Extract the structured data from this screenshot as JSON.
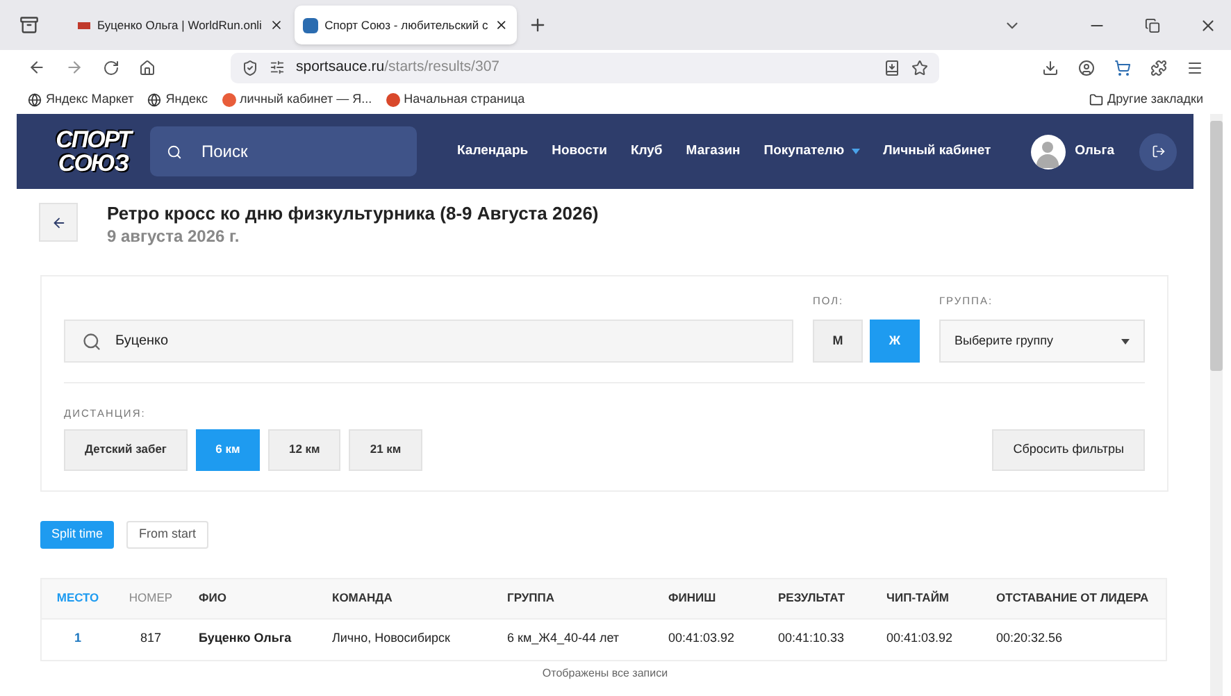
{
  "browser": {
    "tabs": [
      {
        "title": "Буценко Ольга | WorldRun.onli",
        "selected": false
      },
      {
        "title": "Спорт Союз - любительский с",
        "selected": true
      }
    ],
    "url_host": "sportsauce.ru",
    "url_path": "/starts/results/307",
    "bookmarks": [
      "Яндекс Маркет",
      "Яндекс",
      "личный кабинет — Я...",
      "Начальная страница"
    ],
    "other_bookmarks": "Другие закладки"
  },
  "header": {
    "logo_top": "СПОРТ",
    "logo_bottom": "СОЮЗ",
    "search_placeholder": "Поиск",
    "nav": [
      {
        "label": "Календарь",
        "dropdown": false
      },
      {
        "label": "Новости",
        "dropdown": false
      },
      {
        "label": "Клуб",
        "dropdown": false
      },
      {
        "label": "Магазин",
        "dropdown": false
      },
      {
        "label": "Покупателю",
        "dropdown": true
      },
      {
        "label": "Личный кабинет",
        "dropdown": false
      }
    ],
    "user": "Ольга"
  },
  "event": {
    "title": "Ретро кросс ко дню физкультурника (8-9 Августа 2026)",
    "date": "9 августа 2026 г."
  },
  "filters": {
    "search_value": "Буценко",
    "gender_label": "ПОЛ:",
    "genders": [
      {
        "label": "М",
        "selected": false
      },
      {
        "label": "Ж",
        "selected": true
      }
    ],
    "group_label": "ГРУППА:",
    "group_placeholder": "Выберите группу",
    "distance_label": "ДИСТАНЦИЯ:",
    "distances": [
      {
        "label": "Детский забег",
        "selected": false
      },
      {
        "label": "6 км",
        "selected": true
      },
      {
        "label": "12 км",
        "selected": false
      },
      {
        "label": "21 км",
        "selected": false
      }
    ],
    "reset": "Сбросить фильтры"
  },
  "time_modes": [
    {
      "label": "Split time",
      "selected": true
    },
    {
      "label": "From start",
      "selected": false
    }
  ],
  "table": {
    "columns": [
      {
        "label": "МЕСТО",
        "sorted": true
      },
      {
        "label": "НОМЕР",
        "sorted": false
      },
      {
        "label": "ФИО",
        "sorted": false
      },
      {
        "label": "КОМАНДА",
        "sorted": false
      },
      {
        "label": "ГРУППА",
        "sorted": false
      },
      {
        "label": "ФИНИШ",
        "sorted": false
      },
      {
        "label": "РЕЗУЛЬТАТ",
        "sorted": false
      },
      {
        "label": "ЧИП-ТАЙМ",
        "sorted": false
      },
      {
        "label": "ОТСТАВАНИЕ ОТ ЛИДЕРА",
        "sorted": false
      }
    ],
    "rows": [
      [
        "1",
        "817",
        "Буценко Ольга",
        "Лично, Новосибирск",
        "6 км_Ж4_40-44 лет",
        "00:41:03.92",
        "00:41:10.33",
        "00:41:03.92",
        "00:20:32.56"
      ]
    ]
  },
  "footer_note": "Отображены все записи"
}
